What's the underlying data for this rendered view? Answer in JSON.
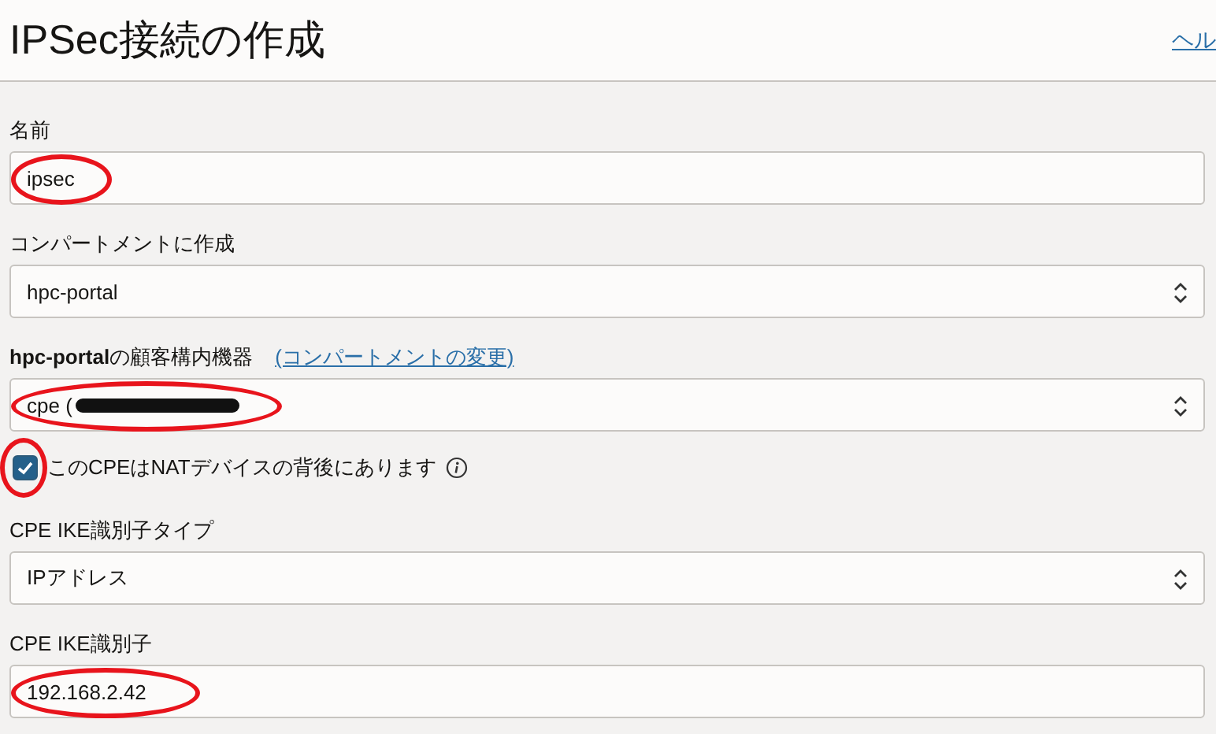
{
  "header": {
    "title": "IPSec接続の作成",
    "help_link": "ヘル"
  },
  "fields": [
    {
      "kind": "text",
      "label": "名前",
      "value": "ipsec",
      "circled": true
    },
    {
      "kind": "select",
      "label": "コンパートメントに作成",
      "value": "hpc-portal"
    },
    {
      "kind": "select",
      "label": "**hpc-portal**の顧客構内機器",
      "link": "(コンパートメントの変更)",
      "value": "cpe (",
      "circled": true,
      "redacted": true
    },
    {
      "kind": "checkbox",
      "label": "このCPEはNATデバイスの背後にあります",
      "checked": true,
      "circled": true
    },
    {
      "kind": "select",
      "label": "CPE IKE識別子タイプ",
      "value": "IPアドレス"
    },
    {
      "kind": "text",
      "label": "CPE IKE識別子",
      "value": "192.168.2.42",
      "circled": true
    }
  ]
}
